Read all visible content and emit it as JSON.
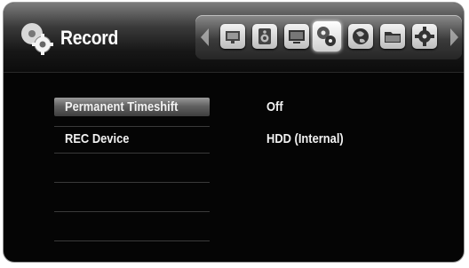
{
  "header": {
    "title": "Record",
    "title_icon": "record-settings-gear-icon",
    "nav_icons": [
      {
        "name": "display-icon"
      },
      {
        "name": "speaker-icon"
      },
      {
        "name": "monitor-icon"
      },
      {
        "name": "record-icon",
        "selected": true
      },
      {
        "name": "globe-icon"
      },
      {
        "name": "folder-icon"
      },
      {
        "name": "gear-icon"
      }
    ]
  },
  "settings": {
    "rows": [
      {
        "label": "Permanent Timeshift",
        "value": "Off",
        "selected": true
      },
      {
        "label": "REC Device",
        "value": "HDD (Internal)",
        "selected": false
      }
    ]
  },
  "colors": {
    "background": "#050505",
    "highlight": "#7a7a7a",
    "text": "#f2f2f2"
  }
}
